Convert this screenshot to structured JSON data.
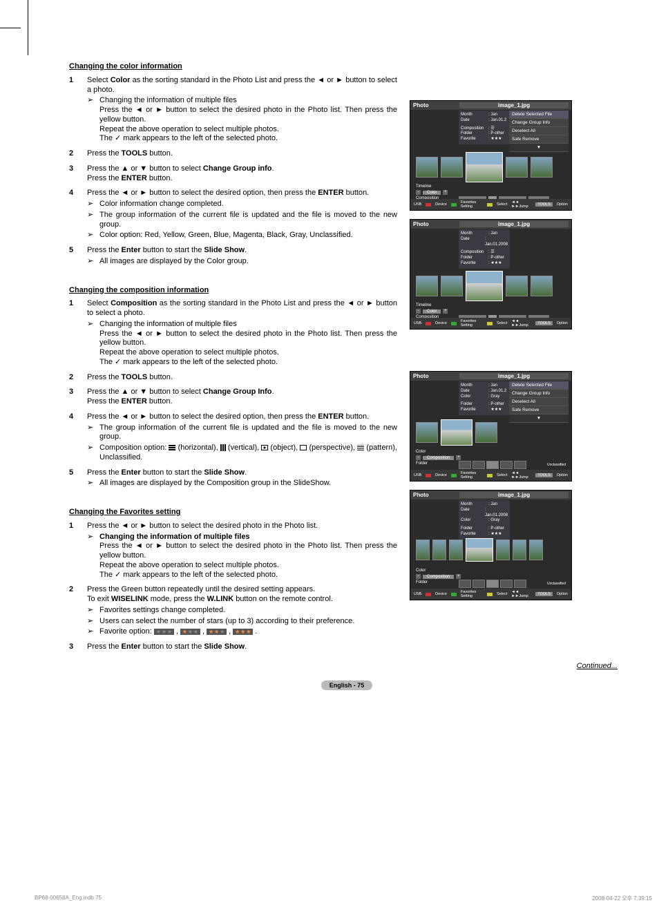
{
  "section1": {
    "heading": "Changing the color information",
    "s1a": "Select ",
    "s1b": "Color",
    "s1c": " as the sorting standard in the Photo List and press the ◄ or ► button to select a photo.",
    "s1sub1": "Changing the information of multiple files",
    "s1sub1b": "Press the ◄ or ► button to select the desired photo in the Photo list. Then press the yellow button.",
    "s1sub1c": "Repeat the above operation to select multiple photos.",
    "s1sub1d": "The ✓ mark appears to the left of the selected photo.",
    "s2a": "Press the ",
    "s2b": "TOOLS",
    "s2c": " button.",
    "s3a": "Press the ▲ or ▼ button to select ",
    "s3b": "Change Group info",
    "s3c": ".",
    "s3d": "Press the ",
    "s3e": "ENTER",
    "s3f": " button.",
    "s4a": "Press the ◄ or ► button to select the desired option, then press the ",
    "s4b": "ENTER",
    "s4c": " button.",
    "s4sub1": "Color information change completed.",
    "s4sub2": "The group information of the current file is updated and the file is moved to the new group.",
    "s4sub3": "Color option: Red, Yellow, Green, Blue, Magenta, Black, Gray, Unclassified.",
    "s5a": "Press the ",
    "s5b": "Enter",
    "s5c": " button to start the ",
    "s5d": "Slide Show",
    "s5e": ".",
    "s5sub1": "All images are displayed by the Color group."
  },
  "section2": {
    "heading": "Changing the composition information",
    "s1a": "Select ",
    "s1b": "Composition",
    "s1c": " as the sorting standard in the Photo List and press the ◄ or ► button to select a photo.",
    "s1sub1": "Changing the information of multiple files",
    "s1sub1b": "Press the ◄ or ► button to select the desired photo in the Photo list. Then press the yellow button.",
    "s1sub1c": "Repeat the above operation to select multiple photos.",
    "s1sub1d": "The ✓ mark appears to the left of the selected photo.",
    "s2a": "Press the ",
    "s2b": "TOOLS",
    "s2c": " button.",
    "s3a": "Press the ▲ or ▼ button to select ",
    "s3b": "Change Group Info",
    "s3c": ".",
    "s3d": "Press the ",
    "s3e": "ENTER",
    "s3f": " button.",
    "s4a": "Press the ◄ or ► button to select the desired option, then press the ",
    "s4b": "ENTER",
    "s4c": " button.",
    "s4sub1": "The group information of the current file is updated and the file is moved to the new group.",
    "s4sub2a": "Composition option: ",
    "s4sub2b": " (horizontal), ",
    "s4sub2c": " (vertical), ",
    "s4sub2d": " (object), ",
    "s4sub2e": " (perspective), ",
    "s4sub2f": " (pattern), Unclassified.",
    "s5a": "Press the ",
    "s5b": "Enter",
    "s5c": " button to start the ",
    "s5d": "Slide Show",
    "s5e": ".",
    "s5sub1": "All images are displayed by the Composition group in the SlideShow."
  },
  "section3": {
    "heading": "Changing the Favorites setting",
    "s1": "Press the ◄ or ► button to select the desired photo in the Photo list.",
    "s1sub1": "Changing the information of multiple files",
    "s1sub1b": "Press the ◄ or ► button to select the desired photo in the Photo list. Then press the yellow button.",
    "s1sub1c": "Repeat the above operation to select multiple photos.",
    "s1sub1d": "The ✓ mark appears to the left of the selected photo.",
    "s2a": "Press the Green button repeatedly until the desired setting appears.",
    "s2b": "To exit ",
    "s2c": "WISELINK",
    "s2d": " mode, press the ",
    "s2e": "W.LINK",
    "s2f": " button on the remote control.",
    "s2sub1": "Favorites settings change completed.",
    "s2sub2": "Users can select the number of stars (up to 3) according to their preference.",
    "s2sub3": "Favorite option: ",
    "s3a": "Press the ",
    "s3b": "Enter",
    "s3c": " button to start the ",
    "s3d": "Slide Show",
    "s3e": "."
  },
  "continued": "Continued...",
  "pagenum": "English - 75",
  "footer": {
    "file": "BP68-00658A_Eng.indb   75",
    "ts": "2008-04-22   오후 7:39:15"
  },
  "shots": {
    "title": "Photo",
    "file": "image_1.jpg",
    "meta1": [
      {
        "k": "Month",
        "v": ": Jan"
      },
      {
        "k": "Date",
        "v": ": Jan.01.2"
      },
      {
        "k": "",
        "v": ""
      },
      {
        "k": "Composition",
        "v": ": ☰"
      },
      {
        "k": "Folder",
        "v": ": P-other"
      },
      {
        "k": "Favorite",
        "v": ": ★★★"
      }
    ],
    "meta1b": [
      {
        "k": "Month",
        "v": ": Jan"
      },
      {
        "k": "Date",
        "v": ": Jan.01.2008"
      },
      {
        "k": "",
        "v": ""
      },
      {
        "k": "Composition",
        "v": ": ☰"
      },
      {
        "k": "Folder",
        "v": ": P-other"
      },
      {
        "k": "Favorite",
        "v": ": ★★★"
      }
    ],
    "meta2": [
      {
        "k": "Month",
        "v": ": Jan"
      },
      {
        "k": "Date",
        "v": ": Jan.01.2"
      },
      {
        "k": "Color",
        "v": ": Gray"
      },
      {
        "k": "",
        "v": ""
      },
      {
        "k": "Folder",
        "v": ": P-other"
      },
      {
        "k": "Favorite",
        "v": ": ★★★"
      }
    ],
    "meta2b": [
      {
        "k": "Month",
        "v": ": Jan"
      },
      {
        "k": "Date",
        "v": ": Jan.01.2008"
      },
      {
        "k": "Color",
        "v": ": Gray"
      },
      {
        "k": "",
        "v": ""
      },
      {
        "k": "Folder",
        "v": ": P-other"
      },
      {
        "k": "Favorite",
        "v": ": ★★★"
      }
    ],
    "menu": [
      "Delete Selected File",
      "Change Group Info",
      "Deselect All",
      "Safe Remove"
    ],
    "side_timeline": "Timeline",
    "side_color": "Color",
    "side_comp": "Composition",
    "side_folder": "Folder",
    "cat_uncl": "Unclassified",
    "foot": {
      "usb": "USB",
      "device": "Device",
      "fav": "Favorites Setting",
      "sel": "Select",
      "jump": "◄◄ ►►Jump",
      "opt": "Option",
      "tools": "TOOLS"
    }
  }
}
